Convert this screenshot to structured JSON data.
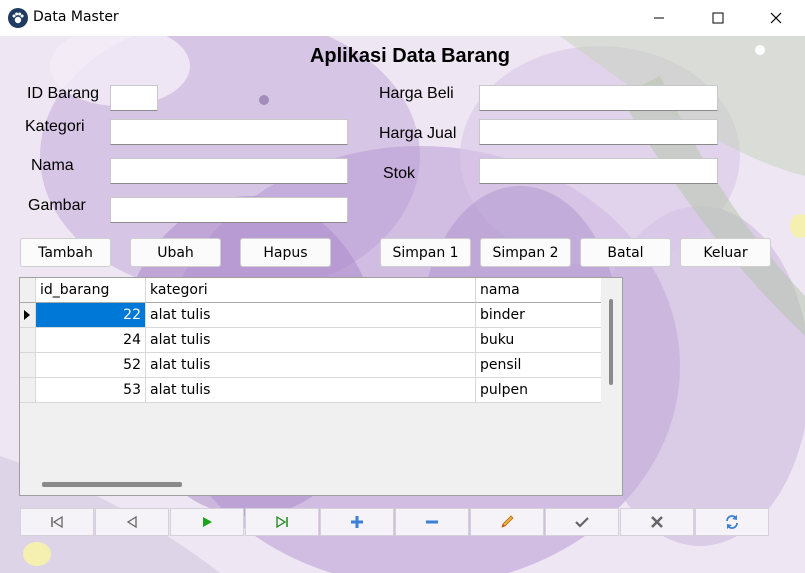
{
  "window": {
    "title": "Data Master",
    "icon": "paw-icon"
  },
  "header": {
    "title": "Aplikasi Data Barang"
  },
  "form": {
    "id_barang_label": "ID Barang",
    "kategori_label": "Kategori",
    "nama_label": "Nama",
    "gambar_label": "Gambar",
    "harga_beli_label": "Harga Beli",
    "harga_jual_label": "Harga Jual",
    "stok_label": "Stok"
  },
  "actions": {
    "tambah": "Tambah",
    "ubah": "Ubah",
    "hapus": "Hapus",
    "simpan1": "Simpan 1",
    "simpan2": "Simpan 2",
    "batal": "Batal",
    "keluar": "Keluar"
  },
  "grid": {
    "columns": [
      "id_barang",
      "kategori",
      "nama"
    ],
    "rows": [
      {
        "id_barang": "22",
        "kategori": "alat tulis",
        "nama": "binder"
      },
      {
        "id_barang": "24",
        "kategori": "alat tulis",
        "nama": "buku"
      },
      {
        "id_barang": "52",
        "kategori": "alat tulis",
        "nama": "pensil"
      },
      {
        "id_barang": "53",
        "kategori": "alat tulis",
        "nama": "pulpen"
      }
    ]
  },
  "navigator": {
    "icons": [
      "first-icon",
      "prior-icon",
      "next-icon",
      "last-icon",
      "insert-icon",
      "delete-icon",
      "edit-icon",
      "post-icon",
      "cancel-icon",
      "refresh-icon"
    ]
  },
  "colors": {
    "selection": "#0078d7",
    "next_green": "#1aa51a",
    "nav_blue": "#3b7fd6"
  }
}
